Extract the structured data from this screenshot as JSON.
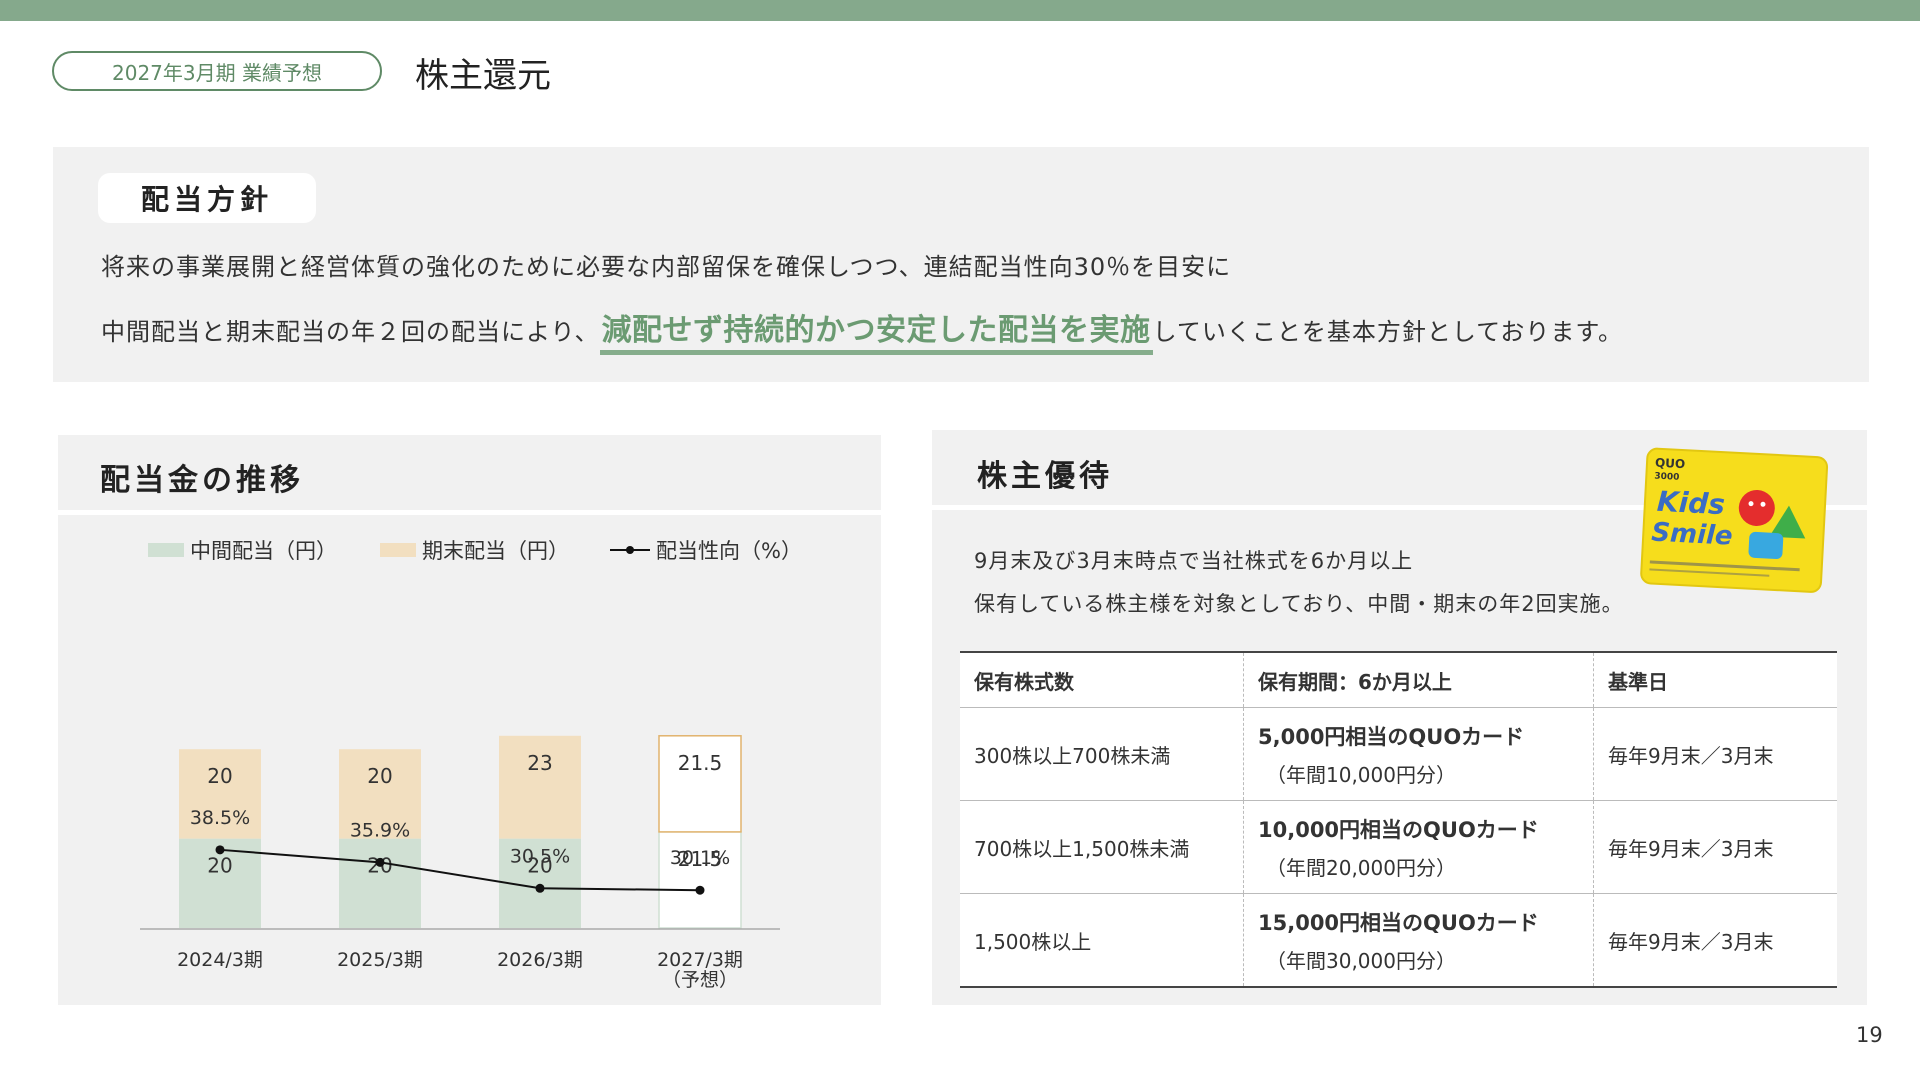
{
  "header": {
    "section_label": "2027年3月期 業績予想",
    "title": "株主還元",
    "accent_color": "#85a98c"
  },
  "policy": {
    "label": "配当方針",
    "line1": "将来の事業展開と経営体質の強化のために必要な内部留保を確保しつつ、連結配当性向30％を目安に",
    "line2_pre": "中間配当と期末配当の年２回の配当により、",
    "line2_emph": "減配せず持続的かつ安定した配当を実施",
    "line2_post": "していくことを基本方針としております。"
  },
  "dividend_panel": {
    "title": "配当金の推移"
  },
  "chart_data": {
    "type": "bar",
    "stacked": true,
    "categories": [
      "2024/3期",
      "2025/3期",
      "2026/3期",
      "2027/3期"
    ],
    "category_sublabels": [
      "",
      "",
      "",
      "（予想）"
    ],
    "series": [
      {
        "name": "中間配当（円）",
        "values": [
          20,
          20,
          20,
          21.5
        ],
        "labels": [
          "20",
          "20",
          "20",
          "21.5"
        ],
        "color": "#d0e0d3"
      },
      {
        "name": "期末配当（円）",
        "values": [
          20,
          20,
          23,
          21.5
        ],
        "labels": [
          "20",
          "20",
          "23",
          "21.5"
        ],
        "color": "#f2dfc0"
      }
    ],
    "line_series": {
      "name": "配当性向（%）",
      "values": [
        38.5,
        35.9,
        30.5,
        30.1
      ],
      "labels": [
        "38.5%",
        "35.9%",
        "30.5%",
        "30.1%"
      ],
      "color": "#111111"
    },
    "forecast_index": 3,
    "forecast_border_color": "#e1b36d",
    "legend": [
      "中間配当（円）",
      "期末配当（円）",
      "配当性向（%）"
    ],
    "legend_position": "top",
    "grid": false
  },
  "benefit_panel": {
    "title": "株主優待",
    "desc1": "9月末及び3月末時点で当社株式を6か月以上",
    "desc2": "保有している株主様を対象としており、中間・期末の年2回実施。",
    "card": {
      "brand": "QUO",
      "value": "3000",
      "line1": "Kids",
      "line2": "Smile"
    },
    "table": {
      "headers": [
        "保有株式数",
        "保有期間：6か月以上",
        "基準日"
      ],
      "rows": [
        {
          "shares": "300株以上700株未満",
          "gift": "5,000円相当のQUOカード",
          "annual": "（年間10,000円分）",
          "date": "毎年9月末／3月末"
        },
        {
          "shares": "700株以上1,500株未満",
          "gift": "10,000円相当のQUOカード",
          "annual": "（年間20,000円分）",
          "date": "毎年9月末／3月末"
        },
        {
          "shares": "1,500株以上",
          "gift": "15,000円相当のQUOカード",
          "annual": "（年間30,000円分）",
          "date": "毎年9月末／3月末"
        }
      ]
    }
  },
  "page_number": "19"
}
